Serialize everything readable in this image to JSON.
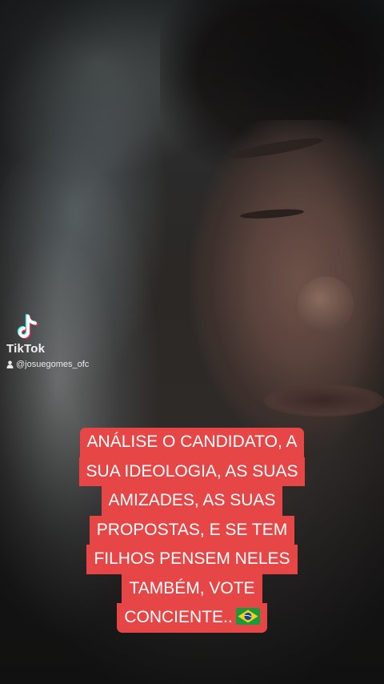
{
  "watermark": {
    "logo_icon": "tiktok-logo-icon",
    "brand": "TikTok",
    "user_icon": "person-icon",
    "username": "@josuegomes_ofc"
  },
  "caption": {
    "background_color": "#e64646",
    "text_color": "#ffffff",
    "lines": [
      "ANÁLISE O CANDIDATO, A",
      "SUA IDEOLOGIA, AS SUAS",
      "AMIZADES, AS SUAS",
      "PROPOSTAS, E SE TEM",
      "FILHOS PENSEM NELES",
      "TAMBÉM, VOTE",
      "CONCIENTE.."
    ],
    "trailing_emoji": "brazil-flag-icon"
  }
}
